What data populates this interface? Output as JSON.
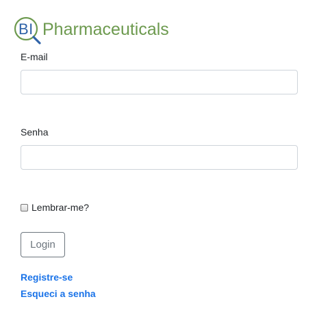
{
  "brand": {
    "mark_text": "BI",
    "name": "Pharmaceuticals",
    "mark_color": "#2f63a8",
    "ring_color": "#6d9a4f",
    "name_color": "#6d9a4f"
  },
  "form": {
    "email_label": "E-mail",
    "email_value": "",
    "email_placeholder": "",
    "password_label": "Senha",
    "password_value": "",
    "password_placeholder": "",
    "remember_label": "Lembrar-me?",
    "remember_checked": false,
    "login_label": "Login"
  },
  "links": {
    "register": "Registre-se",
    "forgot": "Esqueci a senha",
    "color": "#1a73e8"
  }
}
